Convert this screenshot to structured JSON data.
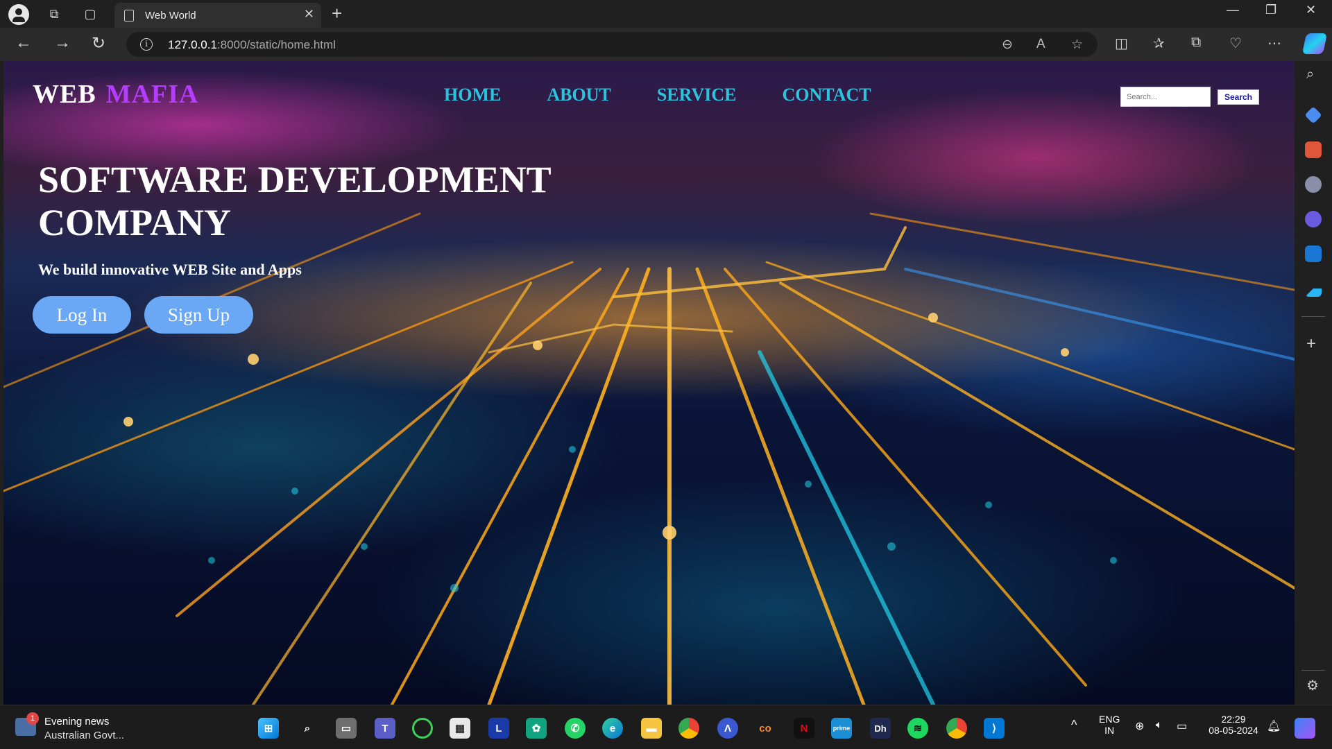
{
  "browser": {
    "tab_title": "Web World",
    "tab_close": "✕",
    "new_tab": "+",
    "url_host": "127.0.0.1",
    "url_path": ":8000/static/home.html",
    "window_min": "—",
    "window_restore": "❐",
    "window_close": "✕"
  },
  "site": {
    "brand_first": "WEB",
    "brand_second": "MAFIA",
    "nav": [
      "HOME",
      "ABOUT",
      "SERVICE",
      "CONTACT"
    ],
    "search_placeholder": "Search...",
    "search_button": "Search",
    "hero_title": "SOFTWARE DEVELOPMENT COMPANY",
    "hero_subtitle": "We build innovative WEB Site and Apps",
    "login_button": "Log In",
    "signup_button": "Sign Up"
  },
  "taskbar": {
    "news_title": "Evening news",
    "news_subtitle": "Australian Govt...",
    "news_badge": "1",
    "lang_top": "ENG",
    "lang_bottom": "IN",
    "time": "22:29",
    "date": "08-05-2024"
  },
  "colors": {
    "brand_accent": "#b43cff",
    "nav_link": "#2ec3dc",
    "button_blue": "#6aa8f5"
  }
}
